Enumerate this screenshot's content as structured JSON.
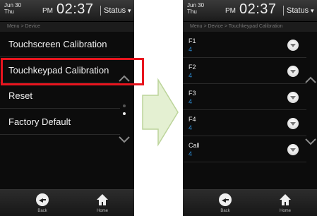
{
  "left": {
    "status": {
      "month_day": "Jun 30",
      "weekday": "Thu",
      "ampm": "PM",
      "time": "02:37",
      "label": "Status"
    },
    "breadcrumb": "Menu > Device",
    "menu_items": [
      "Touchscreen Calibration",
      "Touchkeypad Calibration",
      "Reset",
      "Factory Default"
    ],
    "bottom": {
      "back_label": "Back",
      "home_label": "Home"
    }
  },
  "right": {
    "status": {
      "month_day": "Jun 30",
      "weekday": "Thu",
      "ampm": "PM",
      "time": "02:37",
      "label": "Status"
    },
    "breadcrumb": "Menu > Device > Touchkeypad Calibration",
    "rows": [
      {
        "name": "F1",
        "value": "4"
      },
      {
        "name": "F2",
        "value": "4"
      },
      {
        "name": "F3",
        "value": "4"
      },
      {
        "name": "F4",
        "value": "4"
      },
      {
        "name": "Call",
        "value": "4"
      }
    ],
    "bottom": {
      "back_label": "Back",
      "home_label": "Home"
    }
  },
  "colors": {
    "highlight": "#e8141e",
    "value_blue": "#2e8fd8",
    "arrow_fill": "#e4f0d2"
  },
  "icons": [
    "back-icon",
    "home-icon",
    "dropdown-icon",
    "scroll-up-icon",
    "scroll-down-icon",
    "status-caret-icon"
  ]
}
